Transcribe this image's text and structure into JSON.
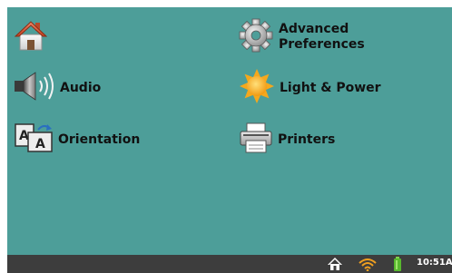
{
  "menu": {
    "home": {
      "icon": "home-icon"
    },
    "audio": {
      "label": "Audio",
      "icon": "speaker-icon"
    },
    "orientation": {
      "label": "Orientation",
      "icon": "orientation-icon"
    },
    "advanced_preferences": {
      "label": "Advanced\nPreferences",
      "icon": "gear-icon"
    },
    "light_power": {
      "label": "Light & Power",
      "icon": "sun-icon"
    },
    "printers": {
      "label": "Printers",
      "icon": "printer-icon"
    }
  },
  "taskbar": {
    "icons": [
      "home-icon",
      "wifi-icon",
      "battery-icon"
    ],
    "clock": "10:51A"
  },
  "colors": {
    "background": "#4d9e99",
    "taskbar": "#3d3d3d",
    "label": "#111111",
    "clock": "#ffffff"
  }
}
